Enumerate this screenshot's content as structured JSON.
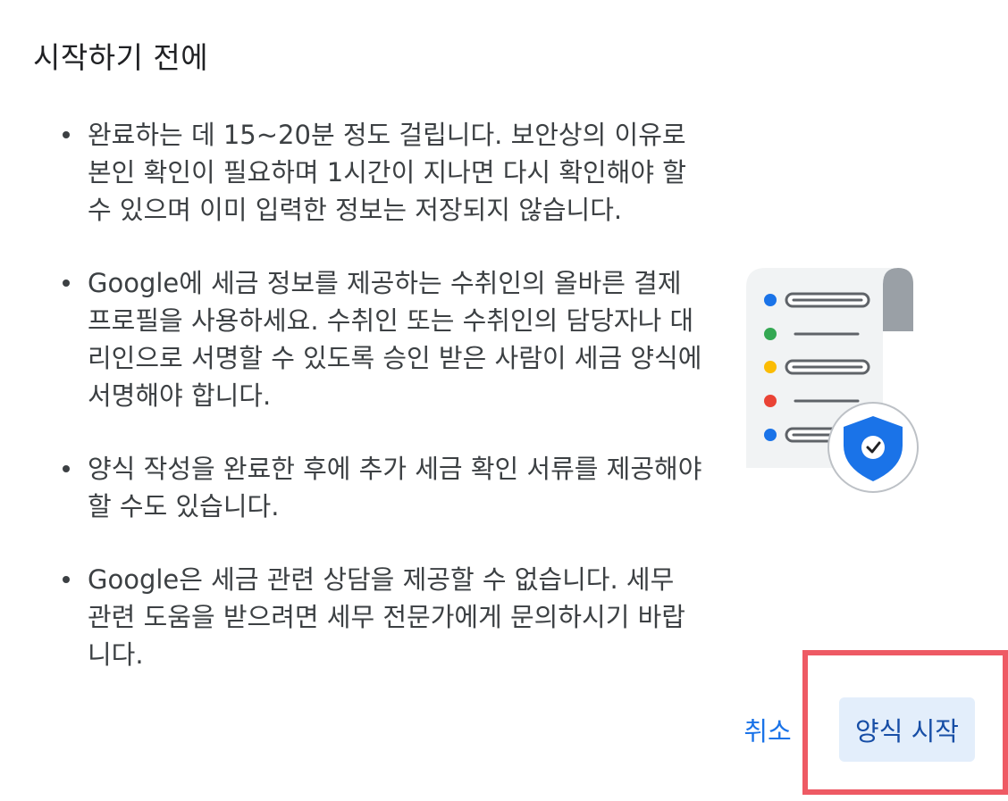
{
  "dialog": {
    "title": "시작하기 전에",
    "items": [
      "완료하는 데 15~20분 정도 걸립니다. 보안상의 이유로 본인 확인이 필요하며 1시간이 지나면 다시 확인해야 할 수 있으며 이미 입력한 정보는 저장되지 않습니다.",
      "Google에 세금 정보를 제공하는 수취인의 올바른 결제 프로필을 사용하세요. 수취인 또는 수취인의 담당자나 대리인으로 서명할 수 있도록 승인 받은 사람이 세금 양식에 서명해야 합니다.",
      "양식 작성을 완료한 후에 추가 세금 확인 서류를 제공해야 할 수도 있습니다.",
      "Google은 세금 관련 상담을 제공할 수 없습니다. 세무 관련 도움을 받으려면 세무 전문가에게 문의하시기 바랍니다."
    ],
    "illustration": {
      "icon": "document-list-shield-icon",
      "dot_colors": [
        "#1a73e8",
        "#34a853",
        "#fbbc04",
        "#ea4335",
        "#1a73e8"
      ],
      "shield_color": "#1a73e8"
    }
  },
  "actions": {
    "cancel_label": "취소",
    "start_label": "양식 시작"
  },
  "colors": {
    "accent": "#1a73e8",
    "highlight": "#ee5a64",
    "primary_button_bg": "#e3eefb"
  }
}
